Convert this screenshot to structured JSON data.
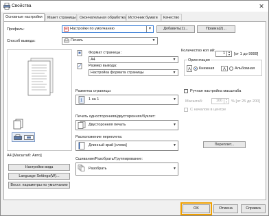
{
  "window": {
    "title": "Свойства",
    "close_glyph": "✕"
  },
  "tabs": [
    "Основные настройки",
    "Макет страницы",
    "Окончательная обработка",
    "Источник бумаги",
    "Качество"
  ],
  "profile": {
    "label": "Профиль:",
    "value": "Настройки по умолчанию",
    "add_button": "Добавить(1)...",
    "edit_button": "Правка(2)..."
  },
  "output_method": {
    "label": "Способ вывода:",
    "value": "Печать"
  },
  "page_size": {
    "label": "Формат страницы:",
    "value": "A4"
  },
  "output_size": {
    "label": "Размер вывода:",
    "value": "Настройка формата страницы"
  },
  "copies": {
    "label": "Количество коп ий:",
    "value": "1",
    "range": "[от 1 до 9999]"
  },
  "orientation": {
    "label": "Ориентация",
    "portrait": "Книжная",
    "landscape": "Альбомная",
    "selected": "portrait"
  },
  "page_layout": {
    "label": "Разметка страницы:",
    "value": "1 на 1"
  },
  "manual_scaling": {
    "label": "Ручная настройка масштаба",
    "scale_label": "Масштаб:",
    "scale_value": "100",
    "scale_range": "% [от 25 до 200]",
    "from_center_label": "С началом в центре"
  },
  "print_mode": {
    "label": "Печать односторонняя/двусторонняя/буклет:",
    "value": "Двусторонняя печать"
  },
  "binding_location": {
    "label": "Расположение переплета:",
    "value": "Длинный край [слева]",
    "gutter_button": "Переплет..."
  },
  "collate": {
    "label": "Сшивание/Разобрать/Группирование:",
    "value": "Разобрать"
  },
  "preview": {
    "caption": "A4 [Масштаб: Авто]"
  },
  "left_buttons": {
    "view_settings": "Настройки вида",
    "language_settings": "Language Settings(W)...",
    "restore_defaults": "Восст. параметры по умолчанию"
  },
  "footer": {
    "ok": "OK",
    "cancel": "Отмена",
    "help": "Справка"
  },
  "colors": {
    "accent": "#3c7fd6",
    "ok_highlight": "#f0a000"
  }
}
